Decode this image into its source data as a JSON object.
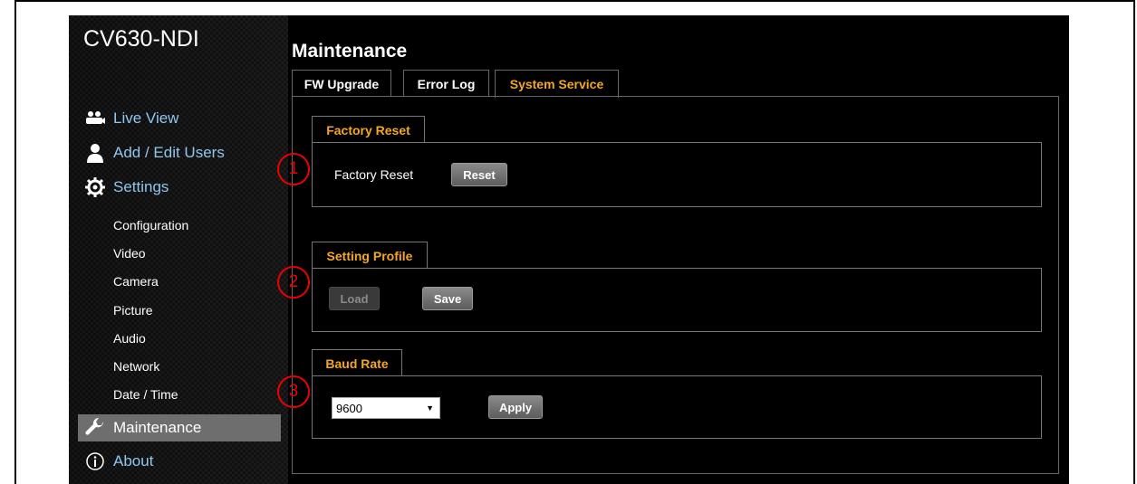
{
  "app": {
    "title": "CV630-NDI"
  },
  "sidebar": {
    "nav": [
      {
        "label": "Live View",
        "icon": "people-icon"
      },
      {
        "label": "Add / Edit Users",
        "icon": "user-icon"
      },
      {
        "label": "Settings",
        "icon": "gear-icon"
      }
    ],
    "sub_items": [
      "Configuration",
      "Video",
      "Camera",
      "Picture",
      "Audio",
      "Network",
      "Date / Time"
    ],
    "maintenance": {
      "label": "Maintenance",
      "icon": "wrench-icon"
    },
    "about": {
      "label": "About",
      "icon": "info-icon"
    }
  },
  "main": {
    "title": "Maintenance",
    "tabs": [
      {
        "label": "FW Upgrade",
        "active": false
      },
      {
        "label": "Error Log",
        "active": false
      },
      {
        "label": "System Service",
        "active": true
      }
    ]
  },
  "factory_reset": {
    "section_title": "Factory Reset",
    "label": "Factory Reset",
    "button": "Reset"
  },
  "setting_profile": {
    "section_title": "Setting Profile",
    "load_button": "Load",
    "load_enabled": false,
    "save_button": "Save"
  },
  "baud_rate": {
    "section_title": "Baud Rate",
    "selected": "9600",
    "apply_button": "Apply"
  },
  "markers": [
    "1",
    "2",
    "3"
  ],
  "colors": {
    "accent": "#f5a623",
    "link": "#8ec7ef",
    "marker": "#e00000",
    "background": "#000000"
  }
}
